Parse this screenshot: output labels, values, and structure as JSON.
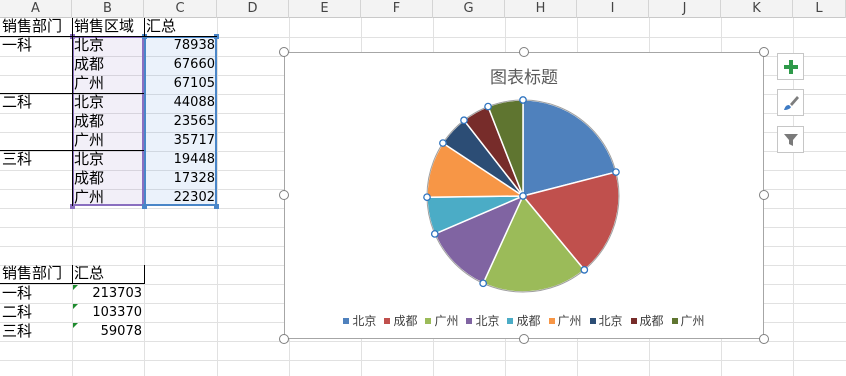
{
  "columns": [
    "A",
    "B",
    "C",
    "D",
    "E",
    "F",
    "G",
    "H",
    "I",
    "J",
    "K",
    "L"
  ],
  "table1": {
    "headers": [
      "销售部门",
      "销售区域",
      "汇总"
    ],
    "groups": [
      {
        "dept": "一科",
        "rows": [
          {
            "region": "北京",
            "total": "78938"
          },
          {
            "region": "成都",
            "total": "67660"
          },
          {
            "region": "广州",
            "total": "67105"
          }
        ]
      },
      {
        "dept": "二科",
        "rows": [
          {
            "region": "北京",
            "total": "44088"
          },
          {
            "region": "成都",
            "total": "23565"
          },
          {
            "region": "广州",
            "total": "35717"
          }
        ]
      },
      {
        "dept": "三科",
        "rows": [
          {
            "region": "北京",
            "total": "19448"
          },
          {
            "region": "成都",
            "total": "17328"
          },
          {
            "region": "广州",
            "total": "22302"
          }
        ]
      }
    ]
  },
  "table2": {
    "headers": [
      "销售部门",
      "汇总"
    ],
    "rows": [
      {
        "dept": "一科",
        "total": "213703"
      },
      {
        "dept": "二科",
        "total": "103370"
      },
      {
        "dept": "三科",
        "total": "59078"
      }
    ]
  },
  "chart_data": {
    "type": "pie",
    "title": "图表标题",
    "categories": [
      "北京",
      "成都",
      "广州",
      "北京",
      "成都",
      "广州",
      "北京",
      "成都",
      "广州"
    ],
    "values": [
      78938,
      67660,
      67105,
      44088,
      23565,
      35717,
      19448,
      17328,
      22302
    ],
    "colors": [
      "#4f81bd",
      "#c0504d",
      "#9bbb59",
      "#8064a2",
      "#4bacc6",
      "#f79646",
      "#2c4d75",
      "#772c2a",
      "#5f7530"
    ],
    "legend_position": "bottom",
    "selected": true
  },
  "chart_buttons": [
    {
      "icon": "plus-icon",
      "label": "图表元素"
    },
    {
      "icon": "brush-icon",
      "label": "图表样式"
    },
    {
      "icon": "filter-icon",
      "label": "图表筛选器"
    }
  ]
}
